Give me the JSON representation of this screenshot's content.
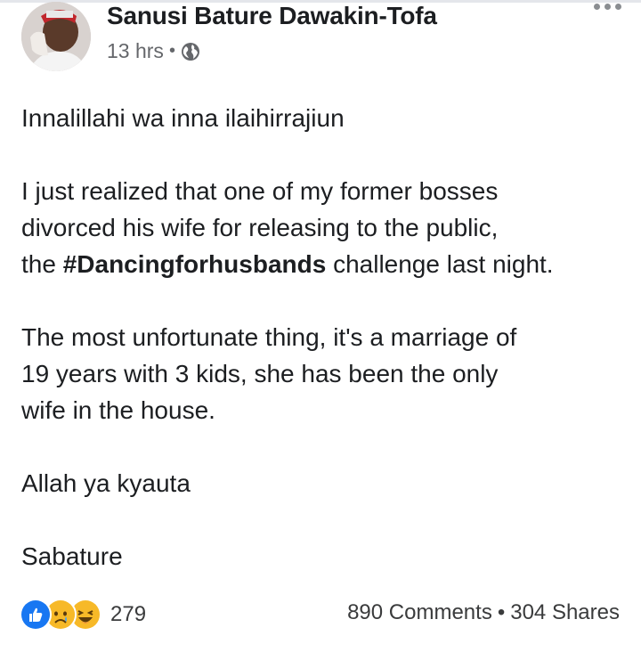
{
  "post": {
    "author": "Sanusi Bature Dawakin-Tofa",
    "time": "13 hrs",
    "privacy_icon": "globe-icon",
    "more_icon": "ellipsis-icon"
  },
  "body": {
    "p1": "Innalillahi wa inna ilaihirrajiun",
    "p2_line1": "I just realized that one of my former bosses",
    "p2_line2": "divorced his wife for releasing to the public,",
    "p2_line3_pre": "the ",
    "p2_hashtag": "#Dancingforhusbands",
    "p2_line3_post": " challenge last night.",
    "p3_line1": "The most unfortunate thing, it's a marriage of",
    "p3_line2": "19 years with 3 kids, she has been the only",
    "p3_line3": "wife in the house.",
    "p4": "Allah ya kyauta",
    "p5": "Sabature"
  },
  "footer": {
    "reaction_icons": [
      "like-icon",
      "sad-icon",
      "haha-icon"
    ],
    "reaction_count": "279",
    "comments": "890 Comments",
    "separator": "•",
    "shares": "304 Shares"
  },
  "colors": {
    "like": "#1877f2",
    "emoji": "#f7b928",
    "meta_text": "#65676b"
  }
}
